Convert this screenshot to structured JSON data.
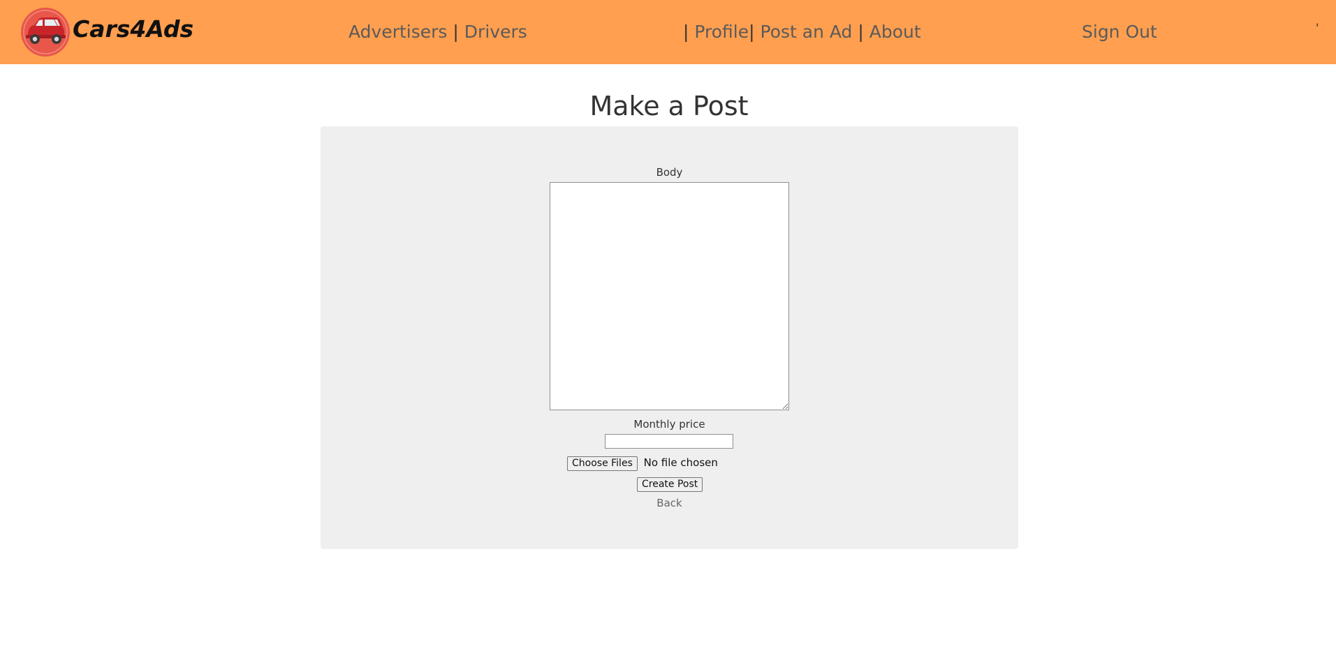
{
  "navbar": {
    "brand": "Cars4Ads",
    "logo_icon": "red-car-logo-icon",
    "advertisers": "Advertisers",
    "drivers": "Drivers",
    "profile": "Profile",
    "post_an_ad": "Post an Ad",
    "about": "About",
    "sign_out": "Sign Out",
    "separator": "|",
    "tick": "'",
    "background_color": "#ff9f4f"
  },
  "page": {
    "title": "Make a Post"
  },
  "form": {
    "body_label": "Body",
    "body_value": "",
    "price_label": "Monthly price",
    "price_value": "",
    "choose_files_label": "Choose Files",
    "file_status": "No file chosen",
    "create_post_label": "Create Post",
    "back_label": "Back",
    "card_color": "#efefef"
  }
}
